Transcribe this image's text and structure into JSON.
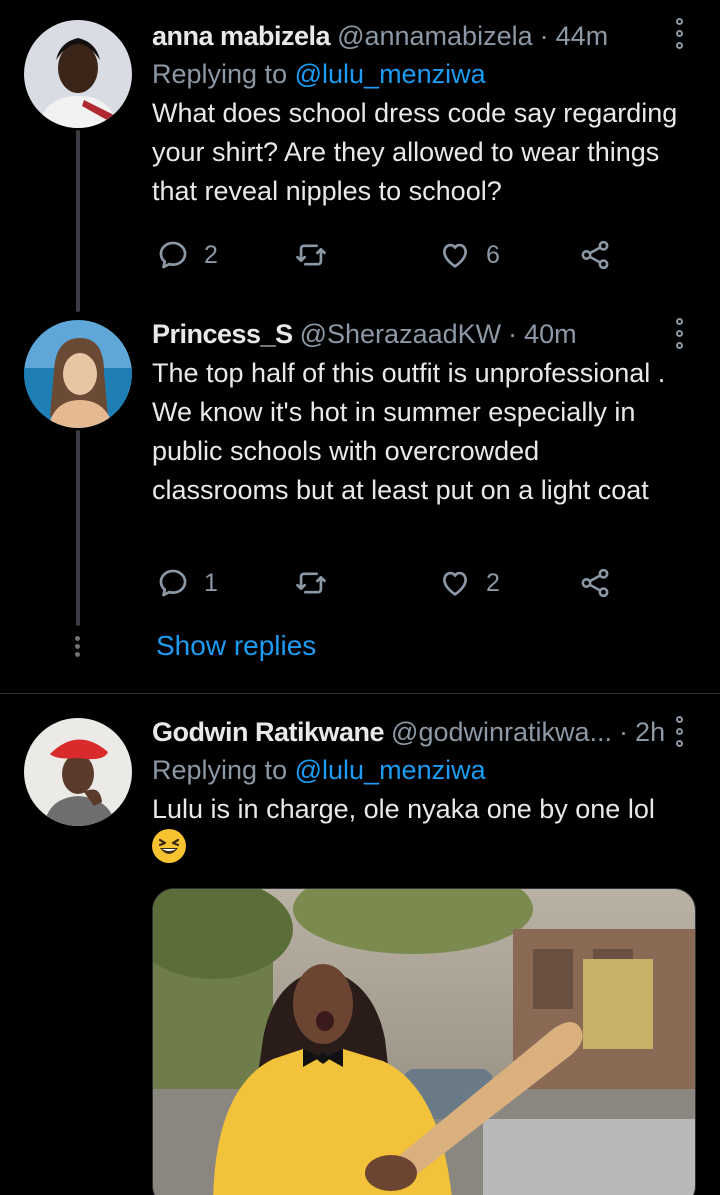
{
  "colors": {
    "background": "#000000",
    "accent": "#1d9bf0",
    "muted": "#8b98a5",
    "text": "#e7e9ea"
  },
  "tweets": [
    {
      "name": "anna mabizela",
      "handle": "@annamabizela",
      "dot": "·",
      "time": "44m",
      "reply_prefix": "Replying to",
      "reply_to": "@lulu_menziwa",
      "text": "What does school dress code say regarding your shirt? Are they allowed to wear things that reveal nipples to school?",
      "replies": "2",
      "likes": "6"
    },
    {
      "name": "Princess_S",
      "handle": "@SherazaadKW",
      "dot": "·",
      "time": "40m",
      "text": "The top half of this outfit is unprofessional . We know it's hot in summer especially in public schools with overcrowded classrooms but at least put on a light coat",
      "replies": "1",
      "likes": "2"
    },
    {
      "name": "Godwin Ratikwane",
      "handle": "@godwinratikwa...",
      "dot": "·",
      "time": "2h",
      "reply_prefix": "Replying to",
      "reply_to": "@lulu_menziwa",
      "text": "Lulu is in charge, ole nyaka one by one lol",
      "emoji": "grinning-squinting-face"
    }
  ],
  "show_replies": "Show replies",
  "icons": [
    "reply-icon",
    "retweet-icon",
    "like-icon",
    "share-icon",
    "more-icon"
  ]
}
